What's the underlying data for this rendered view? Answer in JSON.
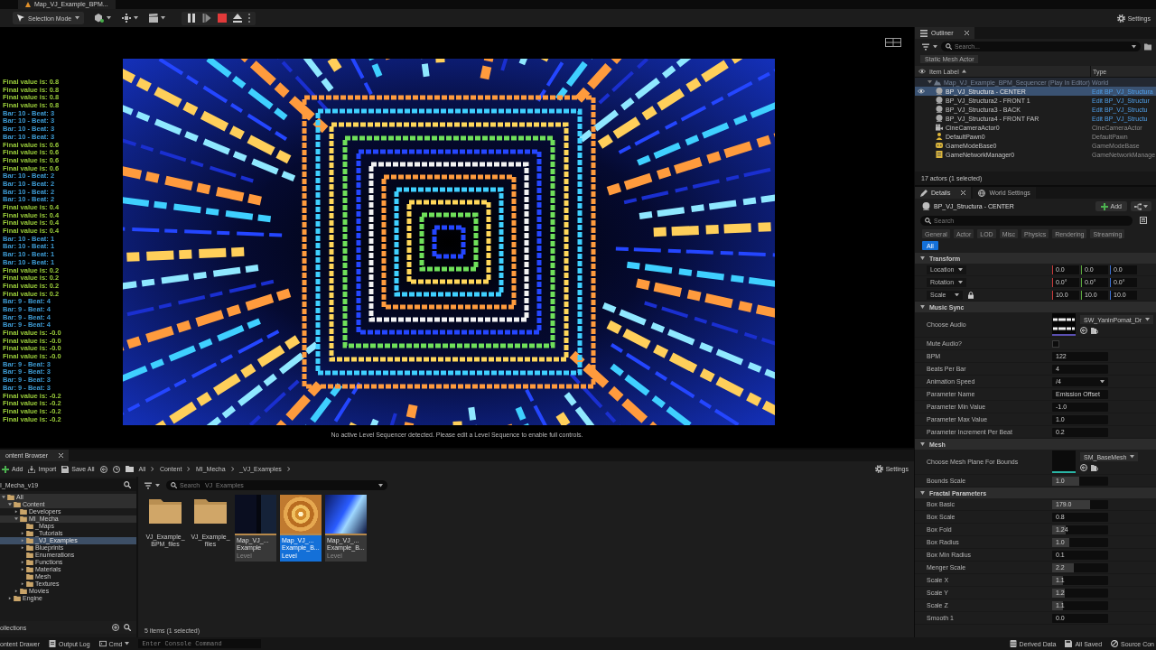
{
  "document_tab": {
    "title": "Map_VJ_Example_BPM..."
  },
  "toolbar": {
    "mode": "Selection Mode",
    "settings": "Settings"
  },
  "viewport": {
    "log": [
      {
        "text": "Final value is: 0.8",
        "color": "#9acd3a"
      },
      {
        "text": "Final value is: 0.8",
        "color": "#9acd3a"
      },
      {
        "text": "Final value is: 0.8",
        "color": "#9acd3a"
      },
      {
        "text": "Final value is: 0.8",
        "color": "#9acd3a"
      },
      {
        "text": "Bar: 10 - Beat: 3",
        "color": "#3c98d0"
      },
      {
        "text": "Bar: 10 - Beat: 3",
        "color": "#3c98d0"
      },
      {
        "text": "Bar: 10 - Beat: 3",
        "color": "#3c98d0"
      },
      {
        "text": "Bar: 10 - Beat: 3",
        "color": "#3c98d0"
      },
      {
        "text": "Final value is: 0.6",
        "color": "#9acd3a"
      },
      {
        "text": "Final value is: 0.6",
        "color": "#9acd3a"
      },
      {
        "text": "Final value is: 0.6",
        "color": "#9acd3a"
      },
      {
        "text": "Final value is: 0.6",
        "color": "#9acd3a"
      },
      {
        "text": "Bar: 10 - Beat: 2",
        "color": "#3c98d0"
      },
      {
        "text": "Bar: 10 - Beat: 2",
        "color": "#3c98d0"
      },
      {
        "text": "Bar: 10 - Beat: 2",
        "color": "#3c98d0"
      },
      {
        "text": "Bar: 10 - Beat: 2",
        "color": "#3c98d0"
      },
      {
        "text": "Final value is: 0.4",
        "color": "#9acd3a"
      },
      {
        "text": "Final value is: 0.4",
        "color": "#9acd3a"
      },
      {
        "text": "Final value is: 0.4",
        "color": "#9acd3a"
      },
      {
        "text": "Final value is: 0.4",
        "color": "#9acd3a"
      },
      {
        "text": "Bar: 10 - Beat: 1",
        "color": "#3c98d0"
      },
      {
        "text": "Bar: 10 - Beat: 1",
        "color": "#3c98d0"
      },
      {
        "text": "Bar: 10 - Beat: 1",
        "color": "#3c98d0"
      },
      {
        "text": "Bar: 10 - Beat: 1",
        "color": "#3c98d0"
      },
      {
        "text": "Final value is: 0.2",
        "color": "#9acd3a"
      },
      {
        "text": "Final value is: 0.2",
        "color": "#9acd3a"
      },
      {
        "text": "Final value is: 0.2",
        "color": "#9acd3a"
      },
      {
        "text": "Final value is: 0.2",
        "color": "#9acd3a"
      },
      {
        "text": "Bar: 9 - Beat: 4",
        "color": "#3c98d0"
      },
      {
        "text": "Bar: 9 - Beat: 4",
        "color": "#3c98d0"
      },
      {
        "text": "Bar: 9 - Beat: 4",
        "color": "#3c98d0"
      },
      {
        "text": "Bar: 9 - Beat: 4",
        "color": "#3c98d0"
      },
      {
        "text": "Final value is: -0.0",
        "color": "#9acd3a"
      },
      {
        "text": "Final value is: -0.0",
        "color": "#9acd3a"
      },
      {
        "text": "Final value is: -0.0",
        "color": "#9acd3a"
      },
      {
        "text": "Final value is: -0.0",
        "color": "#9acd3a"
      },
      {
        "text": "Bar: 9 - Beat: 3",
        "color": "#3c98d0"
      },
      {
        "text": "Bar: 9 - Beat: 3",
        "color": "#3c98d0"
      },
      {
        "text": "Bar: 9 - Beat: 3",
        "color": "#3c98d0"
      },
      {
        "text": "Bar: 9 - Beat: 3",
        "color": "#3c98d0"
      },
      {
        "text": "Final value is: -0.2",
        "color": "#9acd3a"
      },
      {
        "text": "Final value is: -0.2",
        "color": "#9acd3a"
      },
      {
        "text": "Final value is: -0.2",
        "color": "#9acd3a"
      },
      {
        "text": "Final value is: -0.2",
        "color": "#9acd3a"
      }
    ],
    "message": "No active Level Sequencer detected. Please edit a Level Sequence to enable full controls."
  },
  "outliner": {
    "title": "Outliner",
    "search": {
      "placeholder": "Search..."
    },
    "filter_chip": "Static Mesh Actor",
    "columns": [
      "Item Label",
      "Type"
    ],
    "tree": [
      {
        "label": "Map_VJ_Example_BPM_Sequencer (Play In Editor)",
        "type": "World",
        "kind": "world",
        "selected": false,
        "expanded": true,
        "children": [
          {
            "label": "BP_VJ_Structura - CENTER",
            "type": "Edit BP_VJ_Structura",
            "kind": "blueprint",
            "selected": true
          },
          {
            "label": "BP_VJ_Structura2 - FRONT 1",
            "type": "Edit BP_VJ_Structur",
            "kind": "blueprint",
            "selected": false
          },
          {
            "label": "BP_VJ_Structura3 - BACK",
            "type": "Edit BP_VJ_Structu",
            "kind": "blueprint",
            "selected": false
          },
          {
            "label": "BP_VJ_Structura4 - FRONT FAR",
            "type": "Edit BP_VJ_Structu",
            "kind": "blueprint",
            "selected": false
          },
          {
            "label": "CineCameraActor0",
            "type": "CineCameraActor",
            "kind": "camera",
            "selected": false
          },
          {
            "label": "DefaultPawn0",
            "type": "DefaultPawn",
            "kind": "pawn",
            "selected": false
          },
          {
            "label": "GameModeBase0",
            "type": "GameModeBase",
            "kind": "gamemode",
            "selected": false
          },
          {
            "label": "GameNetworkManager0",
            "type": "GameNetworkManage",
            "kind": "info",
            "selected": false
          }
        ]
      }
    ],
    "footer": "17 actors (1 selected)"
  },
  "details": {
    "tabs": [
      {
        "label": "Details",
        "selected": true
      },
      {
        "label": "World Settings",
        "selected": false
      }
    ],
    "actor": "BP_VJ_Structura - CENTER",
    "add": "Add",
    "search": {
      "placeholder": "Search"
    },
    "filters": [
      {
        "label": "General",
        "selected": false
      },
      {
        "label": "Actor",
        "selected": false
      },
      {
        "label": "LOD",
        "selected": false
      },
      {
        "label": "Misc",
        "selected": false
      },
      {
        "label": "Physics",
        "selected": false
      },
      {
        "label": "Rendering",
        "selected": false
      },
      {
        "label": "Streaming",
        "selected": false
      },
      {
        "label": "All",
        "selected": true
      }
    ],
    "sections": [
      {
        "title": "Transform",
        "expanded": true,
        "rows": [
          {
            "kind": "vector",
            "label": "Location",
            "lock": false,
            "values": [
              "0.0",
              "0.0",
              "0.0"
            ]
          },
          {
            "kind": "vector",
            "label": "Rotation",
            "lock": false,
            "values": [
              "0.0°",
              "0.0°",
              "0.0°"
            ]
          },
          {
            "kind": "vector",
            "label": "Scale",
            "lock": true,
            "values": [
              "10.0",
              "10.0",
              "10.0"
            ]
          }
        ]
      },
      {
        "title": "Music Sync",
        "expanded": true,
        "rows": [
          {
            "kind": "audio",
            "label": "Choose Audio",
            "value": "SW_YaninPomat_Dr"
          },
          {
            "kind": "checkbox",
            "label": "Mute Audio?",
            "checked": false
          },
          {
            "kind": "number",
            "label": "BPM",
            "value": "122"
          },
          {
            "kind": "number",
            "label": "Beats Per Bar",
            "value": "4"
          },
          {
            "kind": "dropdown",
            "label": "Animation Speed",
            "value": "/4"
          },
          {
            "kind": "text",
            "label": "Parameter Name",
            "value": "Emission Offset"
          },
          {
            "kind": "number",
            "label": "Parameter Min Value",
            "value": "-1.0"
          },
          {
            "kind": "number",
            "label": "Parameter Max Value",
            "value": "1.0"
          },
          {
            "kind": "number",
            "label": "Parameter Increment Per Beat",
            "value": "0.2"
          }
        ]
      },
      {
        "title": "Mesh",
        "expanded": true,
        "rows": [
          {
            "kind": "mesh",
            "label": "Choose Mesh Plane For Bounds",
            "value": "SM_BaseMesh"
          },
          {
            "kind": "slider",
            "label": "Bounds Scale",
            "value": "1.0",
            "level": 0.48
          }
        ]
      },
      {
        "title": "Fractal Parameters",
        "expanded": true,
        "rows": [
          {
            "kind": "slider",
            "label": "Box Basic",
            "value": "179.0",
            "level": 0.68
          },
          {
            "kind": "number",
            "label": "Box Scale",
            "value": "0.8"
          },
          {
            "kind": "slider",
            "label": "Box Fold",
            "value": "1.24",
            "level": 0.24
          },
          {
            "kind": "slider",
            "label": "Box Radius",
            "value": "1.0",
            "level": 0.3
          },
          {
            "kind": "number",
            "label": "Box Min Radius",
            "value": "0.1"
          },
          {
            "kind": "slider",
            "label": "Menger Scale",
            "value": "2.2",
            "level": 0.38
          },
          {
            "kind": "slider",
            "label": "Scale X",
            "value": "1.1",
            "level": 0.2
          },
          {
            "kind": "slider",
            "label": "Scale Y",
            "value": "1.2",
            "level": 0.22
          },
          {
            "kind": "slider",
            "label": "Scale Z",
            "value": "1.1",
            "level": 0.2
          },
          {
            "kind": "number",
            "label": "Smooth 1",
            "value": "0.0"
          }
        ]
      }
    ]
  },
  "content_browser": {
    "tab": "ontent Browser",
    "add": "Add",
    "import": "Import",
    "save_all": "Save All",
    "breadcrumb": [
      "All",
      "Content",
      "MI_Mecha",
      "_VJ_Examples"
    ],
    "settings": "Settings",
    "tree_title": "I_Mecha_v19",
    "tree": [
      {
        "label": "All",
        "expandable": true,
        "expanded": true,
        "selected": false,
        "highlighted": true,
        "children": [
          {
            "label": "Content",
            "expandable": true,
            "expanded": true,
            "selected": false,
            "highlighted": true,
            "children": [
              {
                "label": "Developers",
                "expandable": true,
                "expanded": false,
                "selected": false,
                "highlighted": false
              },
              {
                "label": "MI_Mecha",
                "expandable": true,
                "expanded": true,
                "selected": false,
                "highlighted": true,
                "children": [
                  {
                    "label": "_Maps",
                    "expandable": false,
                    "selected": false,
                    "highlighted": false
                  },
                  {
                    "label": "_Tutorials",
                    "expandable": true,
                    "expanded": false,
                    "selected": false,
                    "highlighted": false
                  },
                  {
                    "label": "_VJ_Examples",
                    "expandable": true,
                    "expanded": false,
                    "selected": true,
                    "highlighted": false
                  },
                  {
                    "label": "Blueprints",
                    "expandable": true,
                    "expanded": false,
                    "selected": false,
                    "highlighted": false
                  },
                  {
                    "label": "Enumerations",
                    "expandable": false,
                    "selected": false,
                    "highlighted": false
                  },
                  {
                    "label": "Functions",
                    "expandable": true,
                    "expanded": false,
                    "selected": false,
                    "highlighted": false
                  },
                  {
                    "label": "Materials",
                    "expandable": true,
                    "expanded": false,
                    "selected": false,
                    "highlighted": false
                  },
                  {
                    "label": "Mesh",
                    "expandable": false,
                    "selected": false,
                    "highlighted": false
                  },
                  {
                    "label": "Textures",
                    "expandable": true,
                    "expanded": false,
                    "selected": false,
                    "highlighted": false
                  }
                ]
              },
              {
                "label": "Movies",
                "expandable": true,
                "expanded": false,
                "selected": false,
                "highlighted": false
              }
            ]
          },
          {
            "label": "Engine",
            "expandable": true,
            "expanded": false,
            "selected": false,
            "highlighted": false
          }
        ]
      }
    ],
    "collections": "ollections",
    "search": {
      "placeholder": "Search _VJ_Examples"
    },
    "tiles": [
      {
        "kind": "folder",
        "name": "VJ_Example_\nBPM_files",
        "selected": false
      },
      {
        "kind": "folder",
        "name": "VJ_Example_\nfiles",
        "selected": false
      },
      {
        "kind": "level",
        "name": "Map_VJ_...\nExample",
        "type": "Level",
        "selected": false
      },
      {
        "kind": "level",
        "name": "Map_VJ_...\nExample_B...",
        "type": "Level",
        "selected": true
      },
      {
        "kind": "level",
        "name": "Map_VJ_...\nExample_B...",
        "type": "Level",
        "selected": false
      }
    ],
    "footer": "5 items (1 selected)"
  },
  "status_bar": {
    "drawer": "ontent Drawer",
    "output_log": "Output Log",
    "cmd": "Cmd",
    "console": {
      "placeholder": "Enter Console Command"
    },
    "derived_data": "Derived Data",
    "saved": "All Saved",
    "source_control": "Source Con"
  }
}
